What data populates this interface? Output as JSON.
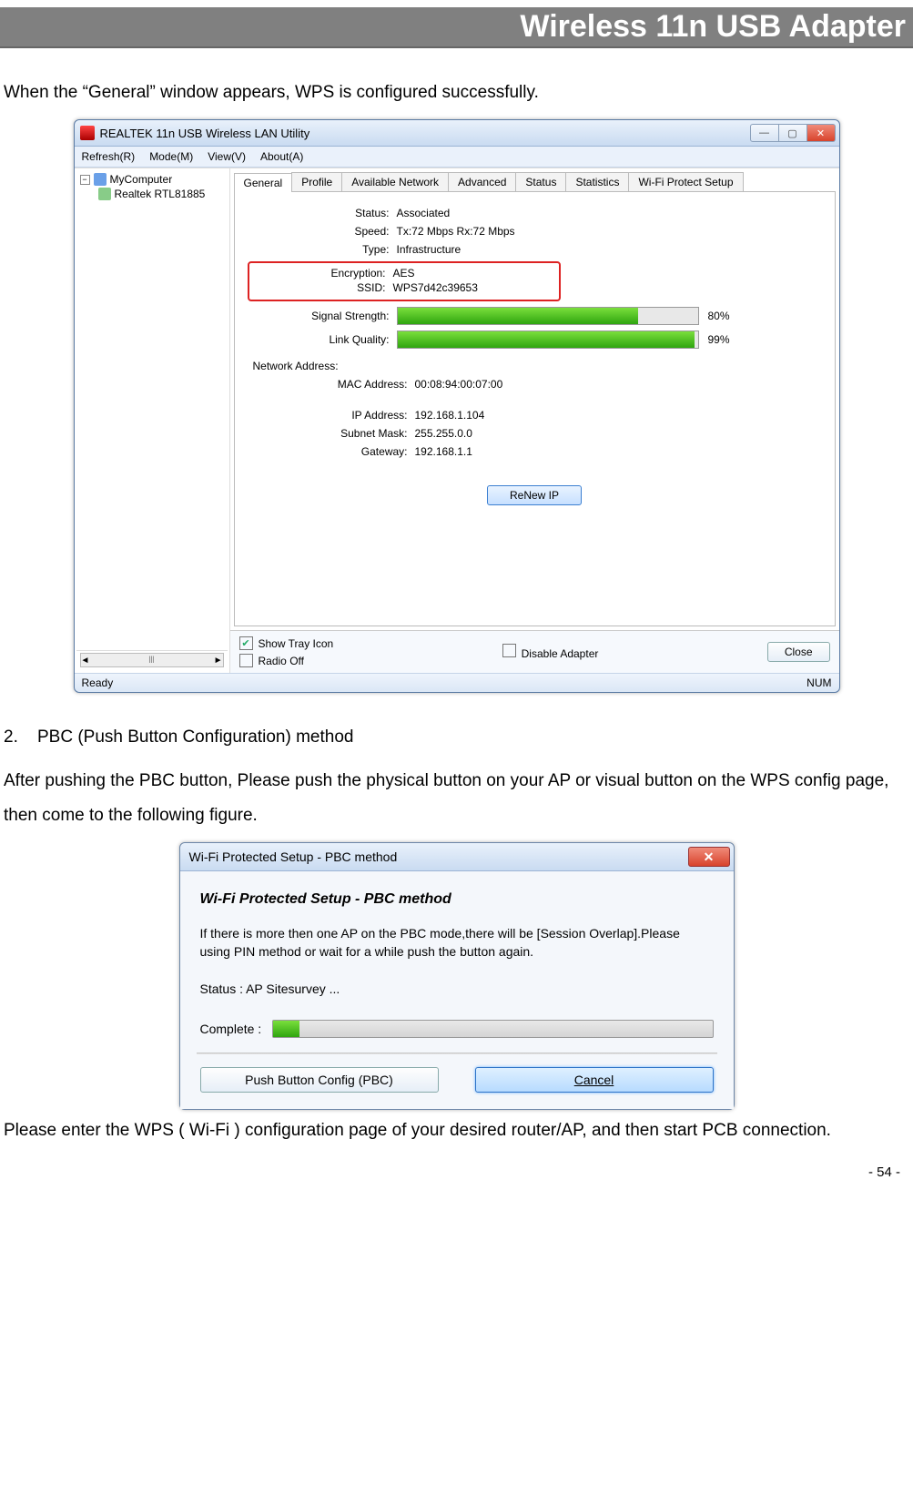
{
  "page_header": "Wireless 11n USB Adapter",
  "intro_text": "When the “General” window appears, WPS is configured successfully.",
  "win": {
    "title": "REALTEK 11n USB Wireless LAN Utility",
    "menu": {
      "refresh": "Refresh(R)",
      "mode": "Mode(M)",
      "view": "View(V)",
      "about": "About(A)"
    },
    "tree": {
      "root": "MyComputer",
      "child": "Realtek RTL81885"
    },
    "tabs": [
      "General",
      "Profile",
      "Available Network",
      "Advanced",
      "Status",
      "Statistics",
      "Wi-Fi Protect Setup"
    ],
    "fields": {
      "status_label": "Status:",
      "status_val": "Associated",
      "speed_label": "Speed:",
      "speed_val": "Tx:72 Mbps Rx:72 Mbps",
      "type_label": "Type:",
      "type_val": "Infrastructure",
      "enc_label": "Encryption:",
      "enc_val": "AES",
      "ssid_label": "SSID:",
      "ssid_val": "WPS7d42c39653",
      "sig_label": "Signal Strength:",
      "sig_pct": "80%",
      "lq_label": "Link Quality:",
      "lq_pct": "99%",
      "netaddr_hdr": "Network Address:",
      "mac_label": "MAC Address:",
      "mac_val": "00:08:94:00:07:00",
      "ip_label": "IP Address:",
      "ip_val": "192.168.1.104",
      "mask_label": "Subnet Mask:",
      "mask_val": "255.255.0.0",
      "gw_label": "Gateway:",
      "gw_val": "192.168.1.1"
    },
    "renew": "ReNew IP",
    "bottom": {
      "tray": "Show Tray Icon",
      "radio": "Radio Off",
      "disable": "Disable Adapter",
      "close": "Close"
    },
    "status_ready": "Ready",
    "status_num": "NUM"
  },
  "section2_num": "2.",
  "section2_title": "PBC (Push Button Configuration) method",
  "section2_para": "After pushing the PBC button, Please push the physical button on your AP or visual button on the WPS config page, then come to the following figure.",
  "dlg": {
    "title": "Wi-Fi Protected Setup - PBC method",
    "heading": "Wi-Fi Protected Setup - PBC method",
    "body": "If there is more then one AP on the PBC mode,there will be [Session Overlap].Please using PIN method or wait for a while push the button again.",
    "status": "Status : AP Sitesurvey ...",
    "complete_label": "Complete :",
    "btn_pbc": "Push Button Config (PBC)",
    "btn_cancel": "Cancel"
  },
  "outro": "Please enter the WPS ( Wi-Fi ) configuration page of your desired router/AP, and then start PCB connection.",
  "page_number": "- 54 -",
  "chart_data": {
    "type": "bar",
    "title": "Connection quality indicators",
    "categories": [
      "Signal Strength",
      "Link Quality"
    ],
    "values": [
      80,
      99
    ],
    "ylim": [
      0,
      100
    ],
    "ylabel": "%"
  }
}
